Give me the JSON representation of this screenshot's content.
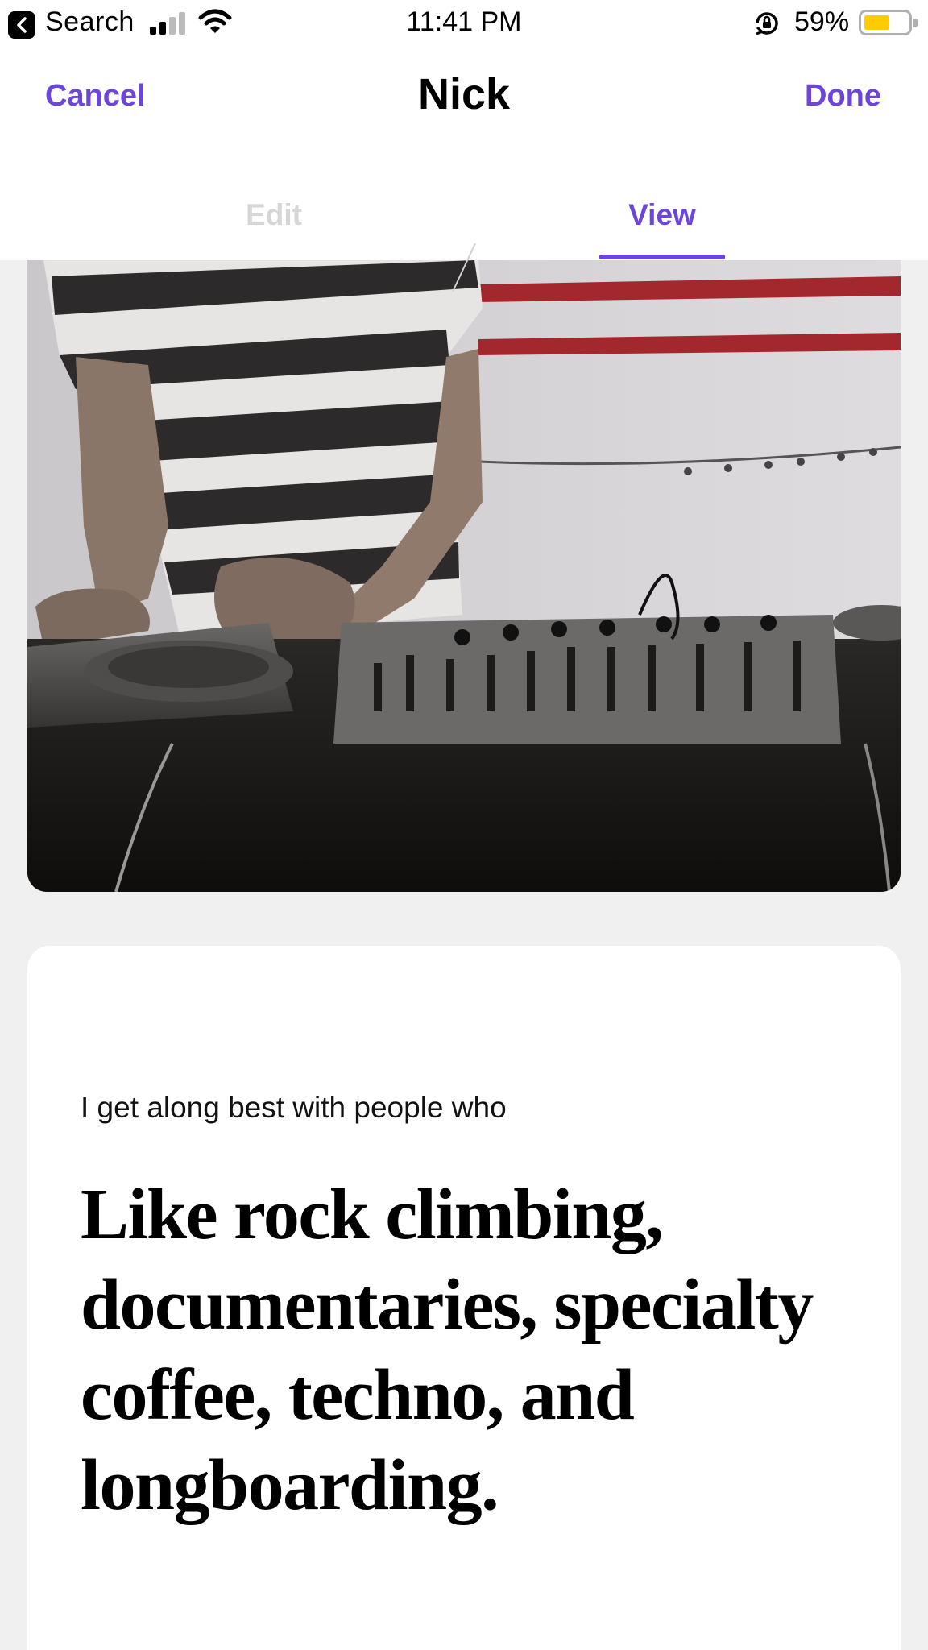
{
  "status_bar": {
    "back_app_label": "Search",
    "time": "11:41 PM",
    "battery_percent": "59%",
    "battery_level": 0.59,
    "battery_color": "#ffcc00",
    "icons": [
      "back-arrow-icon",
      "cellular-signal-icon",
      "wifi-icon",
      "orientation-lock-icon",
      "battery-icon"
    ]
  },
  "header": {
    "cancel_label": "Cancel",
    "title": "Nick",
    "done_label": "Done",
    "accent_color": "#6b45dc"
  },
  "tabs": {
    "items": [
      {
        "label": "Edit",
        "selected": false
      },
      {
        "label": "View",
        "selected": true
      }
    ]
  },
  "profile": {
    "photo": {
      "description_icon": "profile-photo-dj-mixer"
    },
    "prompt_card": {
      "prompt": "I get along best with people who",
      "answer": "Like rock climbing, documentaries, specialty coffee, techno, and longboarding."
    }
  }
}
